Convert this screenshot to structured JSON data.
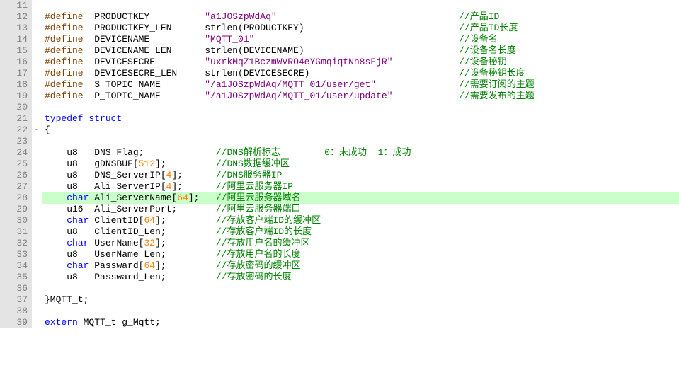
{
  "line_start": 11,
  "line_end": 39,
  "highlight_line": 28,
  "fold_marker": {
    "line": 22,
    "state": "open"
  },
  "lines": [
    {
      "n": 11,
      "seg": [
        {
          "t": ""
        }
      ]
    },
    {
      "n": 12,
      "seg": [
        {
          "c": "kw-pp",
          "t": "#define"
        },
        {
          "t": "  PRODUCTKEY          "
        },
        {
          "c": "str",
          "t": "\"a1JOSzpWdAq\""
        },
        {
          "t": "                                 "
        },
        {
          "c": "cmt",
          "t": "//产品ID"
        }
      ]
    },
    {
      "n": 13,
      "seg": [
        {
          "c": "kw-pp",
          "t": "#define"
        },
        {
          "t": "  PRODUCTKEY_LEN      strlen(PRODUCTKEY)                            "
        },
        {
          "c": "cmt",
          "t": "//产品ID长度"
        }
      ]
    },
    {
      "n": 14,
      "seg": [
        {
          "c": "kw-pp",
          "t": "#define"
        },
        {
          "t": "  DEVICENAME          "
        },
        {
          "c": "str",
          "t": "\"MQTT_01\""
        },
        {
          "t": "                                     "
        },
        {
          "c": "cmt",
          "t": "//设备名"
        }
      ]
    },
    {
      "n": 15,
      "seg": [
        {
          "c": "kw-pp",
          "t": "#define"
        },
        {
          "t": "  DEVICENAME_LEN      strlen(DEVICENAME)                            "
        },
        {
          "c": "cmt",
          "t": "//设备名长度"
        }
      ]
    },
    {
      "n": 16,
      "seg": [
        {
          "c": "kw-pp",
          "t": "#define"
        },
        {
          "t": "  DEVICESECRE         "
        },
        {
          "c": "str",
          "t": "\"uxrkMqZ1BczmWVRO4eYGmqiqtNh8sFjR\""
        },
        {
          "t": "            "
        },
        {
          "c": "cmt",
          "t": "//设备秘钥"
        }
      ]
    },
    {
      "n": 17,
      "seg": [
        {
          "c": "kw-pp",
          "t": "#define"
        },
        {
          "t": "  DEVICESECRE_LEN     strlen(DEVICESECRE)                           "
        },
        {
          "c": "cmt",
          "t": "//设备秘钥长度"
        }
      ]
    },
    {
      "n": 18,
      "seg": [
        {
          "c": "kw-pp",
          "t": "#define"
        },
        {
          "t": "  S_TOPIC_NAME        "
        },
        {
          "c": "str",
          "t": "\"/a1JOSzpWdAq/MQTT_01/user/get\""
        },
        {
          "t": "               "
        },
        {
          "c": "cmt",
          "t": "//需要订阅的主题"
        }
      ]
    },
    {
      "n": 19,
      "seg": [
        {
          "c": "kw-pp",
          "t": "#define"
        },
        {
          "t": "  P_TOPIC_NAME        "
        },
        {
          "c": "str",
          "t": "\"/a1JOSzpWdAq/MQTT_01/user/update\""
        },
        {
          "t": "            "
        },
        {
          "c": "cmt",
          "t": "//需要发布的主题"
        }
      ]
    },
    {
      "n": 20,
      "seg": [
        {
          "t": ""
        }
      ]
    },
    {
      "n": 21,
      "seg": [
        {
          "c": "kw-type",
          "t": "typedef struct"
        }
      ]
    },
    {
      "n": 22,
      "seg": [
        {
          "t": "{"
        }
      ]
    },
    {
      "n": 23,
      "seg": [
        {
          "t": ""
        }
      ]
    },
    {
      "n": 24,
      "seg": [
        {
          "t": "    u8   DNS_Flag;             "
        },
        {
          "c": "cmt",
          "t": "//DNS解析标志        0：未成功  1：成功"
        }
      ]
    },
    {
      "n": 25,
      "seg": [
        {
          "t": "    u8   gDNSBUF["
        },
        {
          "c": "num",
          "t": "512"
        },
        {
          "t": "];         "
        },
        {
          "c": "cmt",
          "t": "//DNS数据缓冲区"
        }
      ]
    },
    {
      "n": 26,
      "seg": [
        {
          "t": "    u8   DNS_ServerIP["
        },
        {
          "c": "num",
          "t": "4"
        },
        {
          "t": "];      "
        },
        {
          "c": "cmt",
          "t": "//DNS服务器IP"
        }
      ]
    },
    {
      "n": 27,
      "seg": [
        {
          "t": "    u8   Ali_ServerIP["
        },
        {
          "c": "num",
          "t": "4"
        },
        {
          "t": "];      "
        },
        {
          "c": "cmt",
          "t": "//阿里云服务器IP"
        }
      ]
    },
    {
      "n": 28,
      "seg": [
        {
          "t": "    "
        },
        {
          "c": "kw-type",
          "t": "char"
        },
        {
          "t": " Ali_ServerName["
        },
        {
          "c": "num",
          "t": "64"
        },
        {
          "t": "];   "
        },
        {
          "c": "cmt",
          "t": "//阿里云服务器域名"
        }
      ]
    },
    {
      "n": 29,
      "seg": [
        {
          "t": "    u16  Ali_ServerPort;       "
        },
        {
          "c": "cmt",
          "t": "//阿里云服务器端口"
        }
      ]
    },
    {
      "n": 30,
      "seg": [
        {
          "t": "    "
        },
        {
          "c": "kw-type",
          "t": "char"
        },
        {
          "t": " ClientID["
        },
        {
          "c": "num",
          "t": "64"
        },
        {
          "t": "];         "
        },
        {
          "c": "cmt",
          "t": "//存放客户端ID的缓冲区"
        }
      ]
    },
    {
      "n": 31,
      "seg": [
        {
          "t": "    u8   ClientID_Len;         "
        },
        {
          "c": "cmt",
          "t": "//存放客户端ID的长度"
        }
      ]
    },
    {
      "n": 32,
      "seg": [
        {
          "t": "    "
        },
        {
          "c": "kw-type",
          "t": "char"
        },
        {
          "t": " UserName["
        },
        {
          "c": "num",
          "t": "32"
        },
        {
          "t": "];         "
        },
        {
          "c": "cmt",
          "t": "//存放用户名的缓冲区"
        }
      ]
    },
    {
      "n": 33,
      "seg": [
        {
          "t": "    u8   UserName_Len;         "
        },
        {
          "c": "cmt",
          "t": "//存放用户名的长度"
        }
      ]
    },
    {
      "n": 34,
      "seg": [
        {
          "t": "    "
        },
        {
          "c": "kw-type",
          "t": "char"
        },
        {
          "t": " Passward["
        },
        {
          "c": "num",
          "t": "64"
        },
        {
          "t": "];         "
        },
        {
          "c": "cmt",
          "t": "//存放密码的缓冲区"
        }
      ]
    },
    {
      "n": 35,
      "seg": [
        {
          "t": "    u8   Passward_Len;         "
        },
        {
          "c": "cmt",
          "t": "//存放密码的长度"
        }
      ]
    },
    {
      "n": 36,
      "seg": [
        {
          "t": ""
        }
      ]
    },
    {
      "n": 37,
      "seg": [
        {
          "t": "}MQTT_t;"
        }
      ]
    },
    {
      "n": 38,
      "seg": [
        {
          "t": ""
        }
      ]
    },
    {
      "n": 39,
      "seg": [
        {
          "c": "kw-type",
          "t": "extern"
        },
        {
          "t": " MQTT_t g_Mqtt;"
        }
      ]
    }
  ]
}
